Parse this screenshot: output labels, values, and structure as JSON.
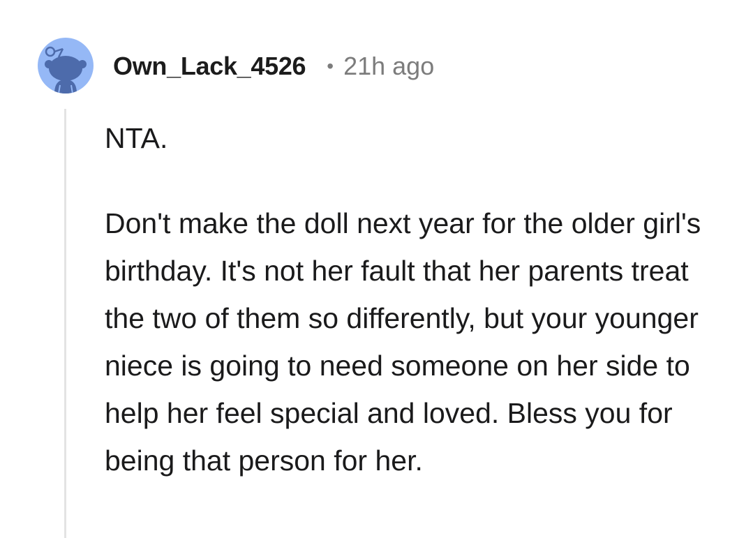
{
  "comment": {
    "username": "Own_Lack_4526",
    "separator": "•",
    "timestamp": "21h ago",
    "avatar_icon": "reddit-snoo-avatar-icon",
    "body": [
      "NTA.",
      "Don't make the doll next year for the older girl's birthday. It's not her fault that her parents treat the two of them so differently, but your younger niece is going to need someone on her side to help her feel special and loved. Bless you for being that person for her."
    ]
  },
  "colors": {
    "avatar_bg": "#95b8f6",
    "avatar_figure": "#4d6bab",
    "username": "#1c1c1c",
    "meta_gray": "#7c7c7c",
    "thread_line": "#e3e3e3",
    "body_text": "#1a1a1b"
  }
}
